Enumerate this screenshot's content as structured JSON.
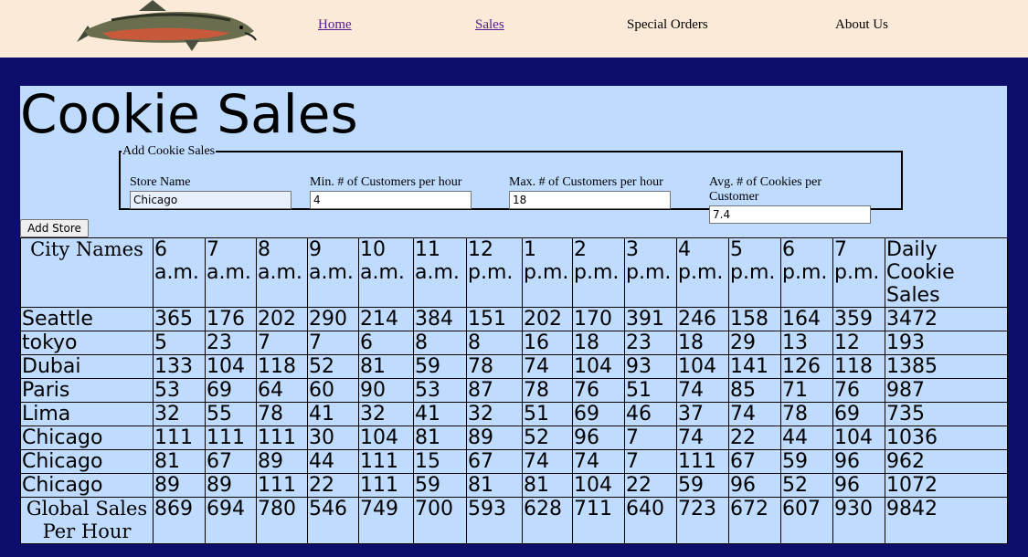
{
  "nav": {
    "home": "Home",
    "sales": "Sales",
    "special_orders": "Special Orders",
    "about": "About Us"
  },
  "page_title": "Cookie Sales",
  "form": {
    "legend": "Add Cookie Sales",
    "store_name_label": "Store Name",
    "store_name_value": "Chicago",
    "min_label": "Min. # of Customers per hour",
    "min_value": "4",
    "max_label": "Max. # of Customers per hour",
    "max_value": "18",
    "avg_label": "Avg. # of Cookies per Customer",
    "avg_value": "7.4",
    "submit_label": "Add Store"
  },
  "table": {
    "city_header": "City Names",
    "total_header": "Daily Cookie Sales",
    "hours": [
      "6 a.m.",
      "7 a.m.",
      "8 a.m.",
      "9 a.m.",
      "10 a.m.",
      "11 a.m.",
      "12 p.m.",
      "1 p.m.",
      "2 p.m.",
      "3 p.m.",
      "4 p.m.",
      "5 p.m.",
      "6 p.m.",
      "7 p.m."
    ],
    "rows": [
      {
        "city": "Seattle",
        "values": [
          365,
          176,
          202,
          290,
          214,
          384,
          151,
          202,
          170,
          391,
          246,
          158,
          164,
          359
        ],
        "total": 3472
      },
      {
        "city": "tokyo",
        "values": [
          5,
          23,
          7,
          7,
          6,
          8,
          8,
          16,
          18,
          23,
          18,
          29,
          13,
          12
        ],
        "total": 193
      },
      {
        "city": "Dubai",
        "values": [
          133,
          104,
          118,
          52,
          81,
          59,
          78,
          74,
          104,
          93,
          104,
          141,
          126,
          118
        ],
        "total": 1385
      },
      {
        "city": "Paris",
        "values": [
          53,
          69,
          64,
          60,
          90,
          53,
          87,
          78,
          76,
          51,
          74,
          85,
          71,
          76
        ],
        "total": 987
      },
      {
        "city": "Lima",
        "values": [
          32,
          55,
          78,
          41,
          32,
          41,
          32,
          51,
          69,
          46,
          37,
          74,
          78,
          69
        ],
        "total": 735
      },
      {
        "city": "Chicago",
        "values": [
          111,
          111,
          111,
          30,
          104,
          81,
          89,
          52,
          96,
          7,
          74,
          22,
          44,
          104
        ],
        "total": 1036
      },
      {
        "city": "Chicago",
        "values": [
          81,
          67,
          89,
          44,
          111,
          15,
          67,
          74,
          74,
          7,
          111,
          67,
          59,
          96
        ],
        "total": 962
      },
      {
        "city": "Chicago",
        "values": [
          89,
          89,
          111,
          22,
          111,
          59,
          81,
          81,
          104,
          22,
          59,
          96,
          52,
          96
        ],
        "total": 1072
      }
    ],
    "footer_label": "Global Sales Per Hour",
    "footer_values": [
      869,
      694,
      780,
      546,
      749,
      700,
      593,
      628,
      711,
      640,
      723,
      672,
      607,
      930
    ],
    "footer_total": 9842
  }
}
